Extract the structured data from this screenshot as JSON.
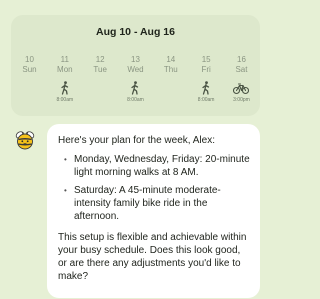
{
  "calendar": {
    "title": "Aug 10 - Aug 16",
    "days": [
      {
        "num": "10",
        "name": "Sun",
        "activity": "",
        "time": ""
      },
      {
        "num": "11",
        "name": "Mon",
        "activity": "walking-icon",
        "time": "8:00am"
      },
      {
        "num": "12",
        "name": "Tue",
        "activity": "",
        "time": ""
      },
      {
        "num": "13",
        "name": "Wed",
        "activity": "walking-icon",
        "time": "8:00am"
      },
      {
        "num": "14",
        "name": "Thu",
        "activity": "",
        "time": ""
      },
      {
        "num": "15",
        "name": "Fri",
        "activity": "walking-icon",
        "time": "8:00am"
      },
      {
        "num": "16",
        "name": "Sat",
        "activity": "bike-icon",
        "time": "3:00pm"
      }
    ]
  },
  "chat": {
    "avatar": "bee-icon",
    "intro": "Here's your plan for the week, Alex:",
    "items": [
      "Monday, Wednesday, Friday: 20-minute light morning walks at 8 AM.",
      "Saturday: A 45-minute moderate-intensity family bike ride in the afternoon."
    ],
    "closing": "This setup is flexible and achievable within your busy schedule. Does this look good, or are there any adjustments you'd like to make?"
  }
}
